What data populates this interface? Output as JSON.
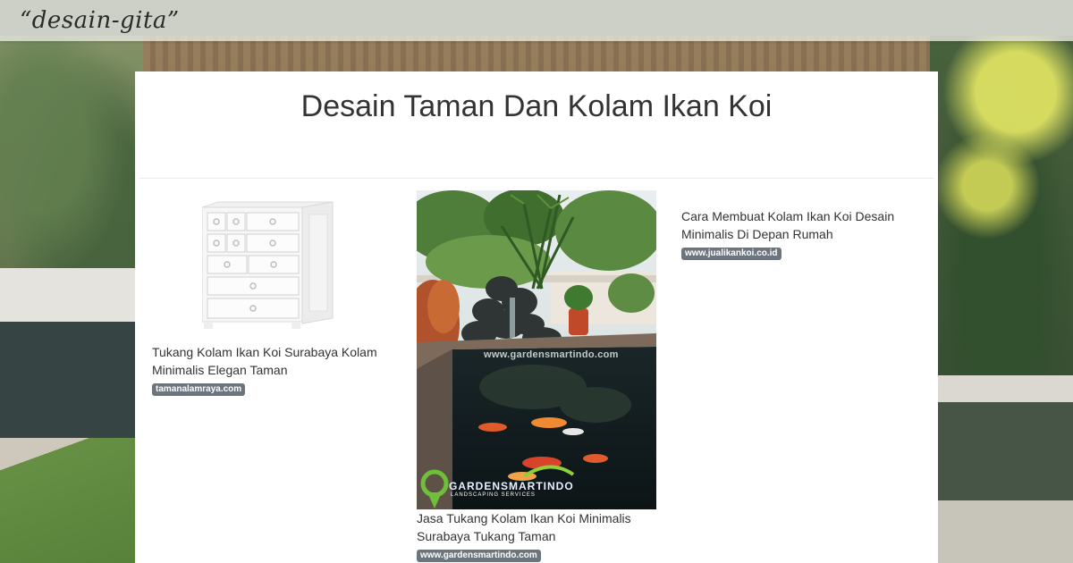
{
  "site": {
    "brand": "“desain-gita”"
  },
  "page": {
    "title": "Desain Taman Dan Kolam Ikan Koi"
  },
  "results": [
    {
      "title_line1": "Tukang Kolam Ikan Koi Surabaya Kolam",
      "title_line2": "Minimalis Elegan Taman",
      "source": "tamanalamraya.com",
      "image": "white-dresser-image"
    },
    {
      "title_line1": "Jasa Tukang Kolam Ikan Koi Minimalis",
      "title_line2": "Surabaya Tukang Taman",
      "source": "www.gardensmartindo.com",
      "image": "koi-pond-image",
      "watermark_url": "www.gardensmartindo.com",
      "watermark_logo": "GARDENSMARTINDO",
      "watermark_sub": "LANDSCAPING SERVICES"
    },
    {
      "title_line1": "Cara Membuat Kolam Ikan Koi Desain",
      "title_line2": "Minimalis Di Depan Rumah",
      "source": "www.jualikankoi.co.id"
    }
  ],
  "colors": {
    "badge": "#6c757d",
    "title_text": "#333333",
    "card_bg": "#ffffff"
  }
}
